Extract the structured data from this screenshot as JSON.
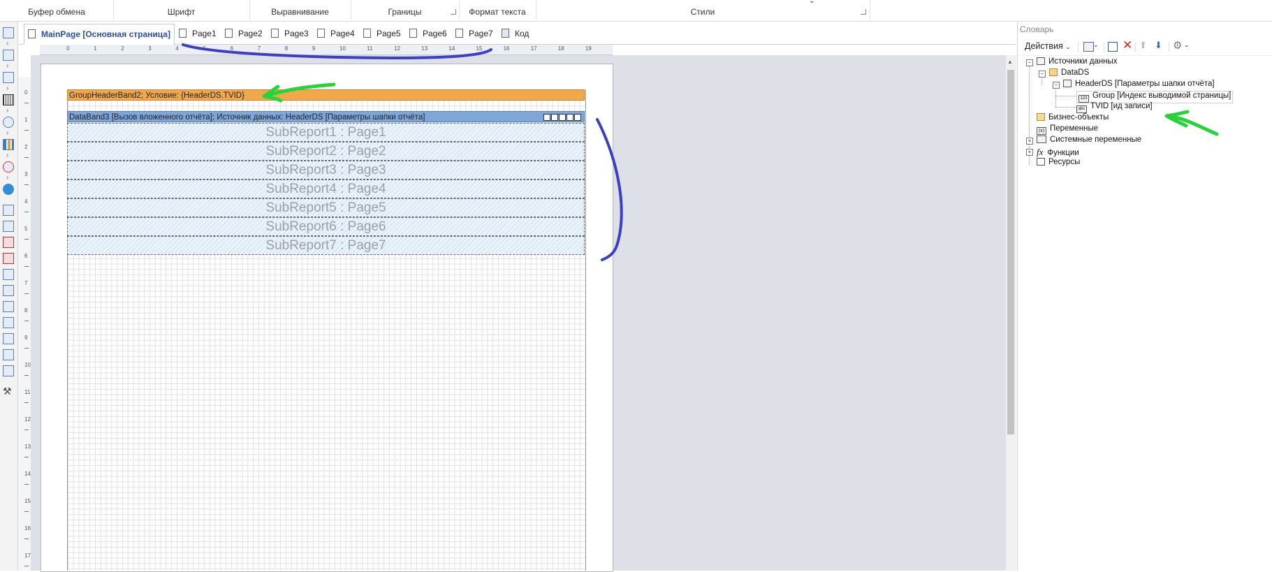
{
  "ribbon": {
    "groups": [
      "Буфер обмена",
      "Шрифт",
      "Выравнивание",
      "Границы",
      "Формат текста",
      "Стили"
    ]
  },
  "tabs": [
    {
      "label": "MainPage [Основная страница]",
      "active": true
    },
    {
      "label": "Page1"
    },
    {
      "label": "Page2"
    },
    {
      "label": "Page3"
    },
    {
      "label": "Page4"
    },
    {
      "label": "Page5"
    },
    {
      "label": "Page6"
    },
    {
      "label": "Page7"
    },
    {
      "label": "Код"
    }
  ],
  "ruler": {
    "h_ticks": [
      "0",
      "1",
      "2",
      "3",
      "4",
      "5",
      "6",
      "7",
      "8",
      "9",
      "10",
      "11",
      "12",
      "13",
      "14",
      "15",
      "16",
      "17",
      "18",
      "19"
    ],
    "v_ticks": [
      "0",
      "1",
      "2",
      "3",
      "4",
      "5",
      "6",
      "7",
      "8",
      "9",
      "10",
      "11",
      "12",
      "13",
      "14",
      "15",
      "16",
      "17"
    ]
  },
  "report": {
    "group_header": "GroupHeaderBand2; Условие: {HeaderDS.TVID}",
    "data_band": "DataBand3 [Вызов вложенного отчёта]; Источник данных: HeaderDS [Параметры шапки отчёта]",
    "subreports": [
      "SubReport1 : Page1",
      "SubReport2 : Page2",
      "SubReport3 : Page3",
      "SubReport4 : Page4",
      "SubReport5 : Page5",
      "SubReport6 : Page6",
      "SubReport7 : Page7"
    ],
    "colors": {
      "group_header": "#f0a84a",
      "data_band": "#7ea6d8"
    }
  },
  "dictionary": {
    "title": "Словарь",
    "actions_label": "Действия",
    "tree": {
      "data_sources": "Источники данных",
      "datads": "DataDS",
      "headerds": "HeaderDS [Параметры шапки отчёта]",
      "group_field": "Group [Индекс выводимой страницы]",
      "group_type": "123",
      "tvid_field": "TVID [ид записи]",
      "tvid_type": "abc",
      "business_objects": "Бизнес-объекты",
      "variables": "Переменные",
      "variables_icon": "(x)",
      "system_variables": "Системные переменные",
      "functions": "Функции",
      "functions_icon": "fx",
      "resources": "Ресурсы"
    }
  },
  "annotations": {
    "blue": "#3b3fc4",
    "green": "#27d33a"
  }
}
